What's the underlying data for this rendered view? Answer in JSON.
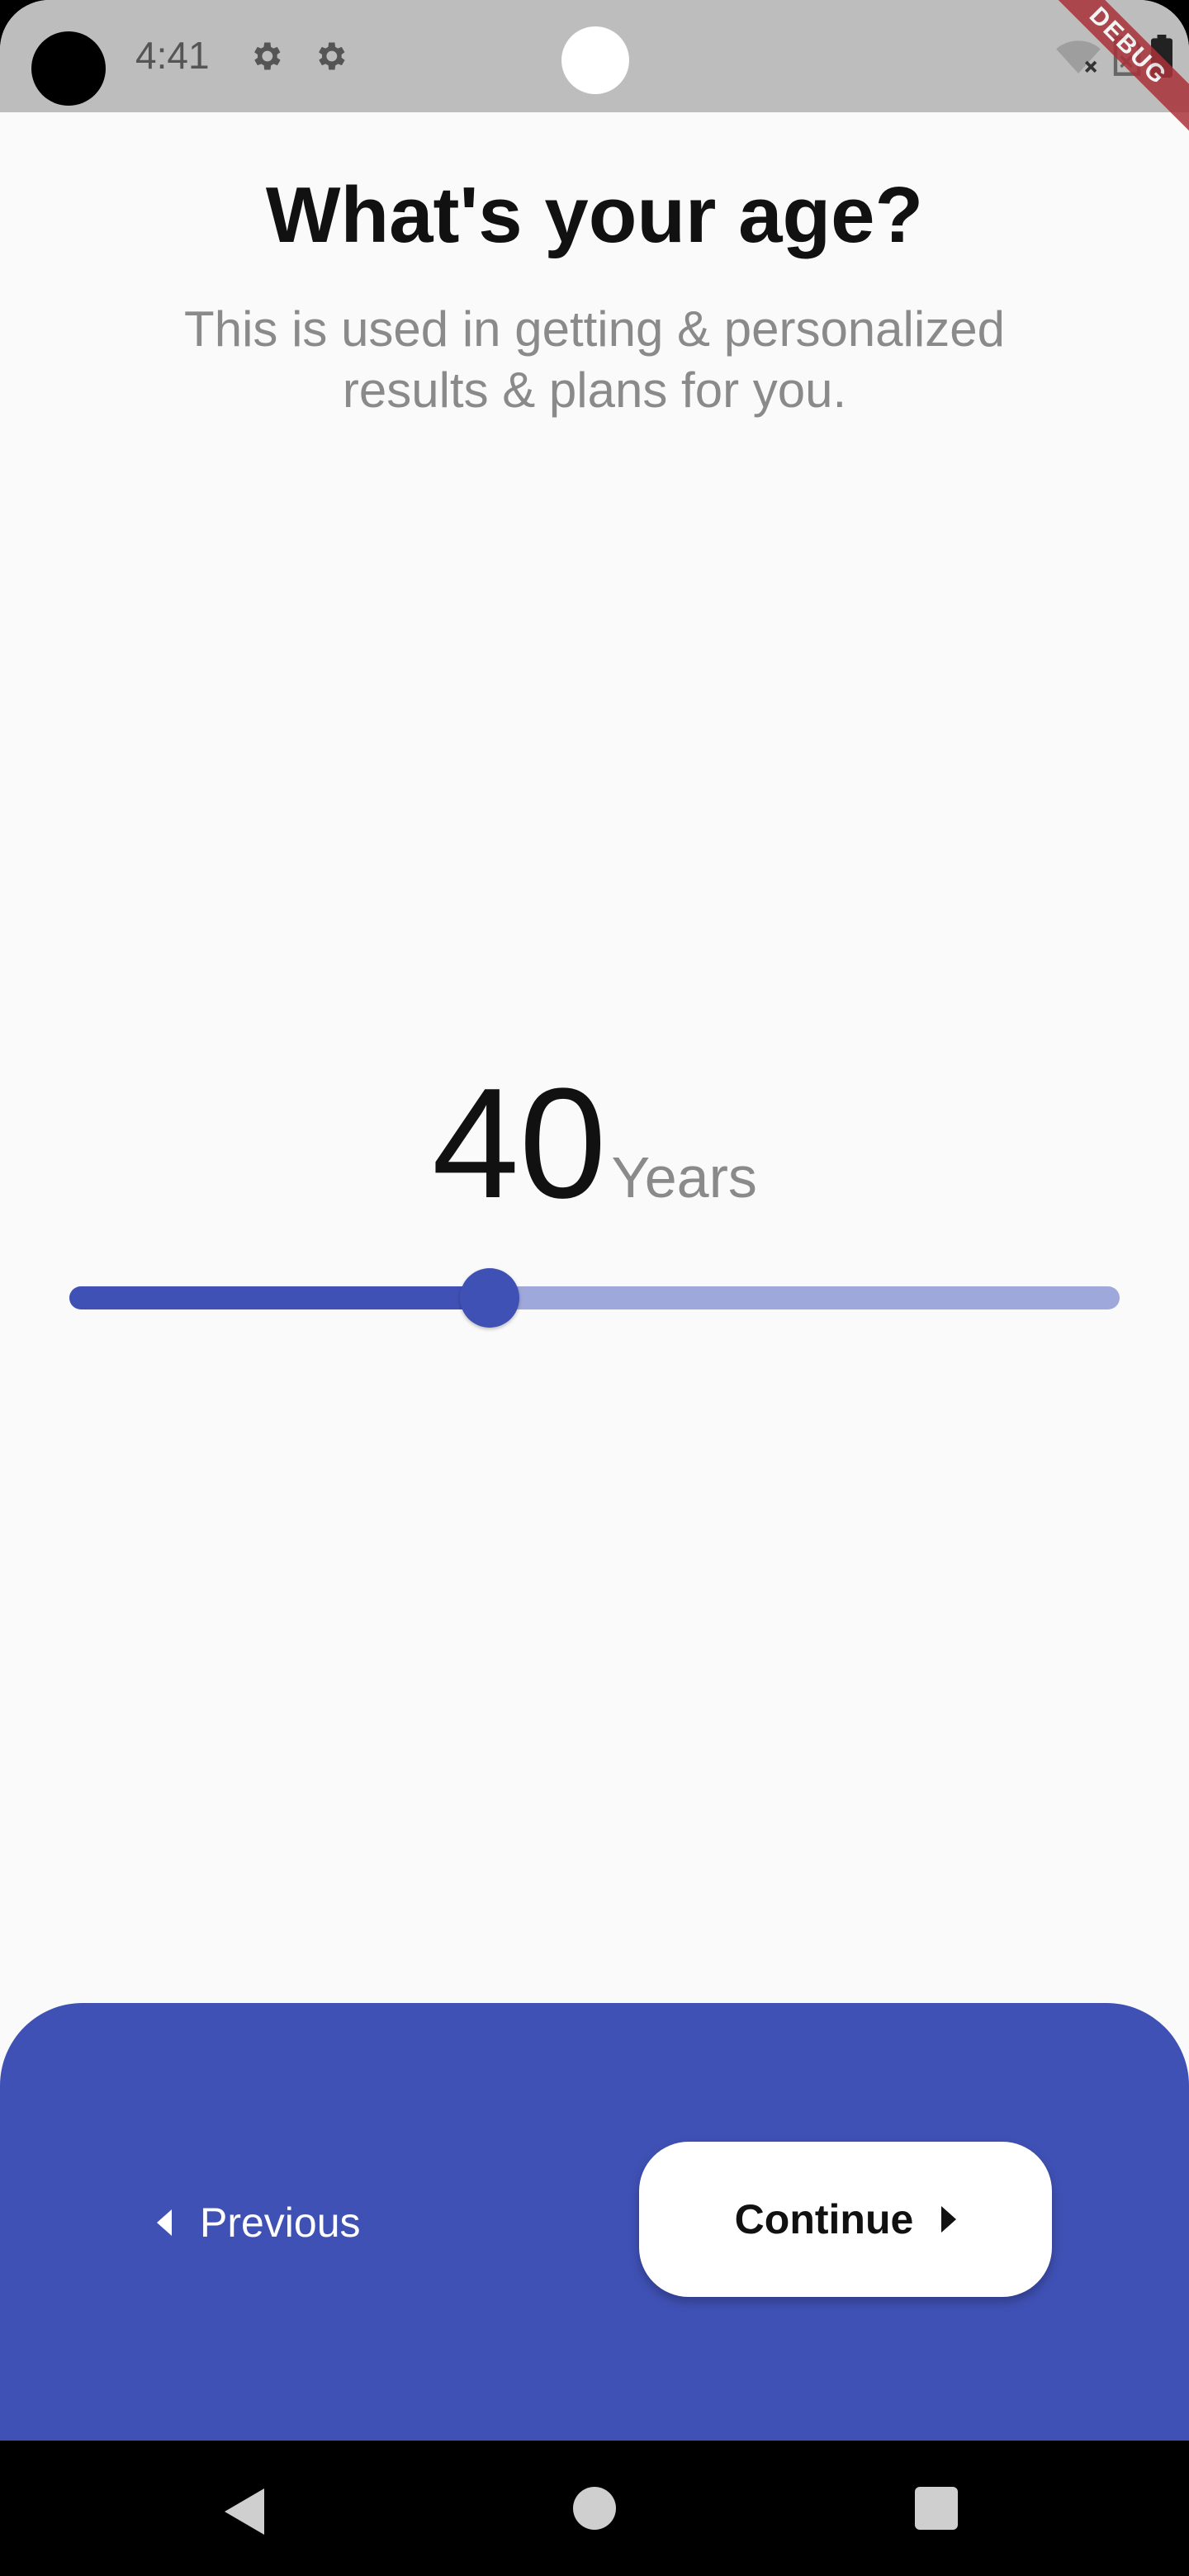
{
  "status_bar": {
    "time": "4:41",
    "debug_banner": "DEBUG"
  },
  "question": {
    "title": "What's your age?",
    "subtitle": "This is used in getting & personalized results & plans for you."
  },
  "age": {
    "value": "40",
    "unit": "Years",
    "slider_fraction": 0.4
  },
  "navigation": {
    "previous_label": "Previous",
    "continue_label": "Continue"
  },
  "colors": {
    "accent": "#3f51b5",
    "track_inactive": "#9fa8da",
    "status_bar": "#bdbdbd",
    "background": "#fafafa"
  }
}
